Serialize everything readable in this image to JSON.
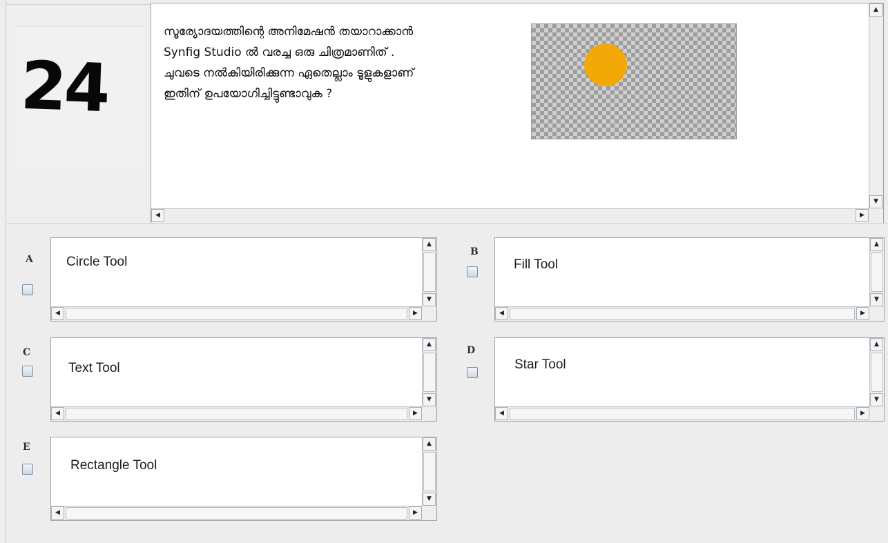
{
  "question": {
    "number": "24",
    "lines": [
      "സൂര്യോദയത്തിന്റെ അനിമേഷൻ തയാറാക്കാൻ",
      "Synfig Studio ൽ വരച്ച ഒരു ചിത്രമാണിത് .",
      "ചുവടെ നൽകിയിരിക്കുന്ന ഏതെല്ലാം ടൂളുകളാണ്",
      "ഇതിന് ഉപയോഗിച്ചിട്ടുണ്ടാവുക ?"
    ],
    "image": {
      "description_icon": "sun-icon",
      "sun_color": "#f2a908"
    }
  },
  "options": [
    {
      "letter": "A",
      "text": "Circle Tool",
      "checked": false
    },
    {
      "letter": "B",
      "text": "Fill Tool",
      "checked": false
    },
    {
      "letter": "C",
      "text": "Text Tool",
      "checked": false
    },
    {
      "letter": "D",
      "text": "Star Tool",
      "checked": false
    },
    {
      "letter": "E",
      "text": "Rectangle Tool",
      "checked": false
    }
  ],
  "scroll_arrows": {
    "up": "▲",
    "down": "▼",
    "left": "◀",
    "right": "▶"
  }
}
